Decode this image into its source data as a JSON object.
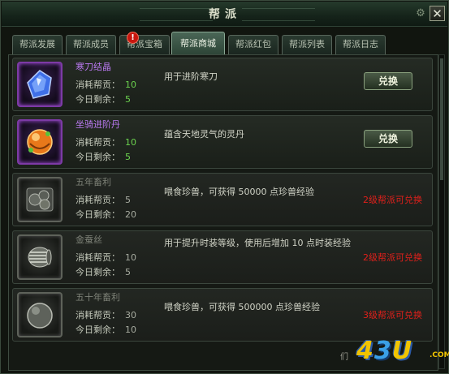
{
  "window": {
    "title": "帮派",
    "close_label": "✕",
    "settings_label": "⚙"
  },
  "tabs": [
    {
      "label": "帮派发展"
    },
    {
      "label": "帮派成员"
    },
    {
      "label": "帮派宝箱"
    },
    {
      "label": "帮派商城"
    },
    {
      "label": "帮派红包"
    },
    {
      "label": "帮派列表"
    },
    {
      "label": "帮派日志"
    }
  ],
  "active_tab": "帮派商城",
  "alert_badge": "!",
  "items": [
    {
      "name": "寒刀结晶",
      "cost_label": "消耗帮贡：",
      "cost": "10",
      "remain_label": "今日剩余：",
      "remain": "5",
      "desc": "用于进阶寒刀",
      "button": "兑换",
      "icon": "blue-crystal-icon"
    },
    {
      "name": "坐骑进阶丹",
      "cost_label": "消耗帮贡：",
      "cost": "10",
      "remain_label": "今日剩余：",
      "remain": "5",
      "desc": "蕴含天地灵气的灵丹",
      "button": "兑换",
      "icon": "orange-pill-icon"
    },
    {
      "name": "五年畜利",
      "cost_label": "消耗帮贡：",
      "cost": "5",
      "remain_label": "今日剩余：",
      "remain": "20",
      "desc": "喂食珍兽，可获得 50000 点珍兽经验",
      "requirement": "2级帮派可兑换",
      "icon": "grey-pills-icon"
    },
    {
      "name": "金蚕丝",
      "cost_label": "消耗帮贡：",
      "cost": "10",
      "remain_label": "今日剩余：",
      "remain": "5",
      "desc": "用于提升时装等级，使用后增加 10 点时装经验",
      "requirement": "2级帮派可兑换",
      "icon": "silk-roll-icon"
    },
    {
      "name": "五十年畜利",
      "cost_label": "消耗帮贡：",
      "cost": "30",
      "remain_label": "今日剩余：",
      "remain": "10",
      "desc": "喂食珍兽，可获得 500000 点珍兽经验",
      "requirement": "3级帮派可兑换",
      "icon": "grey-orb-icon"
    }
  ],
  "watermark": {
    "prefix": "们",
    "logo_a": "4",
    "logo_b": "3",
    "logo_c": "U",
    "domain": ".COM"
  }
}
